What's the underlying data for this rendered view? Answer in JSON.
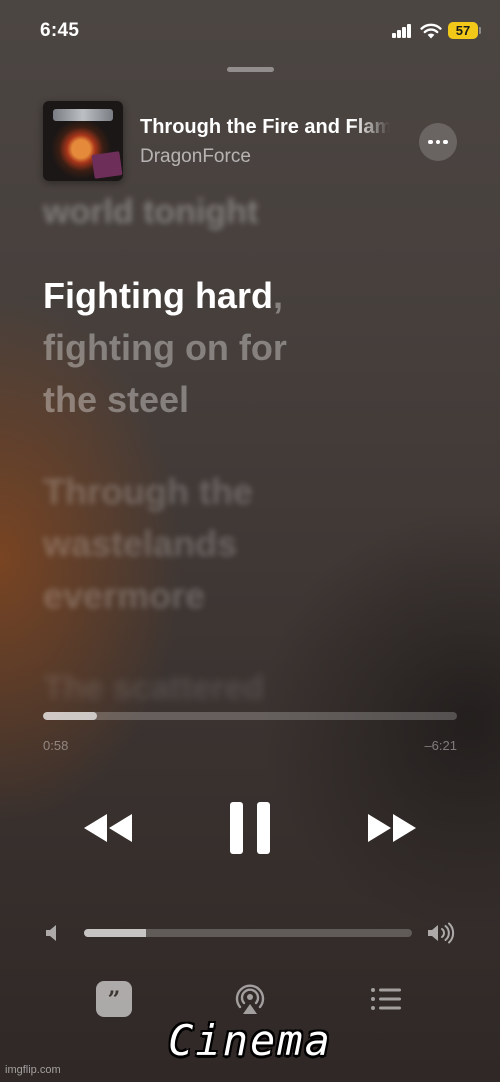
{
  "status_bar": {
    "time": "6:45",
    "battery": "57"
  },
  "now_playing": {
    "title": "Through the Fire and Flames",
    "artist": "DragonForce"
  },
  "lyrics": {
    "previous": "world tonight",
    "current_sung": "Fighting hard",
    "current_unsung_1": ",",
    "current_unsung_2": "fighting on for",
    "current_unsung_3": "the steel",
    "next_1": "Through the",
    "next_2": "wastelands",
    "next_3": "evermore",
    "faded": "The scattered"
  },
  "playback": {
    "elapsed": "0:58",
    "remaining": "–6:21",
    "progress_fraction": 0.13
  },
  "volume": {
    "level_fraction": 0.19
  },
  "bottom_bar": {
    "lyrics_button_glyph": "”"
  },
  "overlay": {
    "caption": "Cinema",
    "watermark": "imgflip.com"
  },
  "colors": {
    "battery": "#f2c919"
  }
}
